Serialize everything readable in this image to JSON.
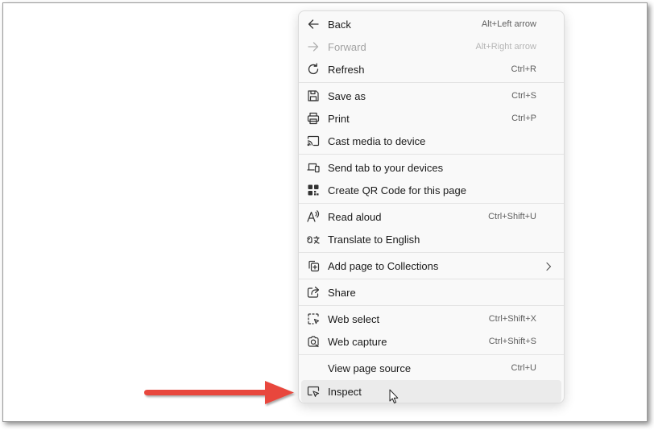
{
  "context_menu": {
    "items": [
      {
        "label": "Back",
        "shortcut": "Alt+Left arrow",
        "icon": "back-arrow-icon"
      },
      {
        "label": "Forward",
        "shortcut": "Alt+Right arrow",
        "icon": "forward-arrow-icon",
        "disabled": true
      },
      {
        "label": "Refresh",
        "shortcut": "Ctrl+R",
        "icon": "refresh-icon"
      },
      {
        "label": "Save as",
        "shortcut": "Ctrl+S",
        "icon": "save-icon"
      },
      {
        "label": "Print",
        "shortcut": "Ctrl+P",
        "icon": "printer-icon"
      },
      {
        "label": "Cast media to device",
        "shortcut": "",
        "icon": "cast-icon"
      },
      {
        "label": "Send tab to your devices",
        "shortcut": "",
        "icon": "devices-icon"
      },
      {
        "label": "Create QR Code for this page",
        "shortcut": "",
        "icon": "qr-code-icon"
      },
      {
        "label": "Read aloud",
        "shortcut": "Ctrl+Shift+U",
        "icon": "read-aloud-icon"
      },
      {
        "label": "Translate to English",
        "shortcut": "",
        "icon": "translate-icon"
      },
      {
        "label": "Add page to Collections",
        "shortcut": "",
        "icon": "collections-icon",
        "has_submenu": true
      },
      {
        "label": "Share",
        "shortcut": "",
        "icon": "share-icon"
      },
      {
        "label": "Web select",
        "shortcut": "Ctrl+Shift+X",
        "icon": "web-select-icon"
      },
      {
        "label": "Web capture",
        "shortcut": "Ctrl+Shift+S",
        "icon": "web-capture-icon"
      },
      {
        "label": "View page source",
        "shortcut": "Ctrl+U",
        "icon": ""
      },
      {
        "label": "Inspect",
        "shortcut": "",
        "icon": "inspect-icon",
        "hovered": true
      }
    ]
  },
  "colors": {
    "menu_background": "#f9f9f9",
    "hover_background": "#ebebeb",
    "annotation_arrow": "#e8463c"
  }
}
